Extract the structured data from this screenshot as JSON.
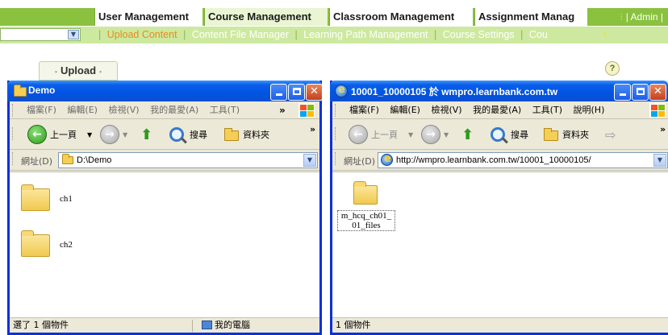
{
  "app_tabs": {
    "user_management": "User Management",
    "course_management": "Course Management",
    "classroom_management": "Classroom Management",
    "assignment_management": "Assignment Manag",
    "admin": "Admin"
  },
  "subnav": {
    "links": [
      "Upload Content",
      "Content File Manager",
      "Learning Path Management",
      "Course Settings",
      "Cou"
    ]
  },
  "upload_button": {
    "label": "Upload"
  },
  "help": {
    "label": "?"
  },
  "left_window": {
    "title": "Demo",
    "menu": [
      "檔案(F)",
      "編輯(E)",
      "檢視(V)",
      "我的最愛(A)",
      "工具(T)"
    ],
    "menu_overflow": "»",
    "toolbar": {
      "back": "上一頁",
      "search": "搜尋",
      "folders": "資料夾",
      "overflow": "»"
    },
    "address_label": "網址(D)",
    "address_value": "D:\\Demo",
    "items": [
      {
        "name": "ch1"
      },
      {
        "name": "ch2"
      }
    ],
    "status": {
      "selection": "選了 1 個物件",
      "location": "我的電腦"
    }
  },
  "right_window": {
    "title": "10001_10000105 於 wmpro.learnbank.com.tw",
    "menu": [
      "檔案(F)",
      "編輯(E)",
      "檢視(V)",
      "我的最愛(A)",
      "工具(T)",
      "說明(H)"
    ],
    "toolbar": {
      "back": "上一頁",
      "search": "搜尋",
      "folders": "資料夾",
      "overflow": "»"
    },
    "address_label": "網址(D)",
    "address_value": "http://wmpro.learnbank.com.tw/10001_10000105/",
    "items": [
      {
        "name_line1": "m_hcq_ch01_",
        "name_line2": "01_files"
      }
    ],
    "status": {
      "count": "1 個物件"
    }
  }
}
